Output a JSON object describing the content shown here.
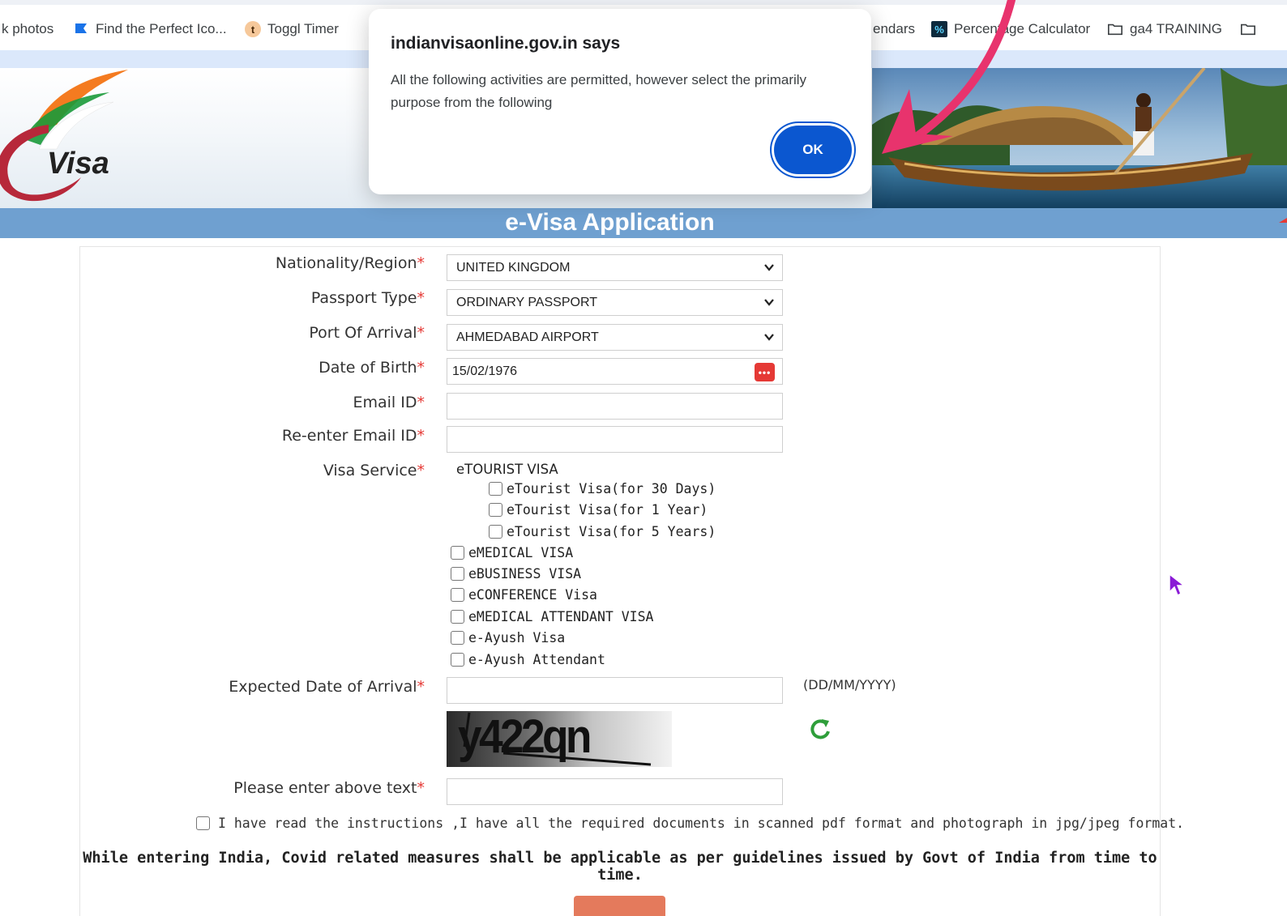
{
  "bookmarks": [
    {
      "label": "k photos",
      "icon": "photos-icon"
    },
    {
      "label": "Find the Perfect Ico...",
      "icon": "flag-icon"
    },
    {
      "label": "Toggl Timer",
      "icon": "toggl-icon"
    },
    {
      "label": "endars",
      "icon": "calendar-icon"
    },
    {
      "label": "Percentage Calculator",
      "icon": "percent-icon"
    },
    {
      "label": "ga4 TRAINING",
      "icon": "folder-icon"
    }
  ],
  "header": {
    "logo_text": "Visa",
    "title": "e-Visa Application"
  },
  "dialog": {
    "title": "indianvisaonline.gov.in says",
    "message": "All the following activities are permitted, however select the primarily purpose from the following",
    "ok_label": "OK"
  },
  "form": {
    "required_mark": "*",
    "nationality": {
      "label": "Nationality/Region",
      "value": "UNITED KINGDOM"
    },
    "passport_type": {
      "label": "Passport Type",
      "value": "ORDINARY PASSPORT"
    },
    "port_of_arrival": {
      "label": "Port Of Arrival",
      "value": "AHMEDABAD AIRPORT"
    },
    "date_of_birth": {
      "label": "Date of Birth",
      "value": "15/02/1976"
    },
    "email": {
      "label": "Email ID",
      "value": ""
    },
    "reenter_email": {
      "label": "Re-enter Email ID",
      "value": ""
    },
    "visa_service": {
      "label": "Visa Service",
      "group_label": "eTOURIST VISA",
      "tourist_options": [
        "eTourist Visa(for 30 Days)",
        "eTourist Visa(for 1 Year)",
        "eTourist Visa(for 5 Years)"
      ],
      "other_options": [
        "eMEDICAL VISA",
        "eBUSINESS VISA",
        "eCONFERENCE Visa",
        "eMEDICAL ATTENDANT VISA",
        "e-Ayush Visa",
        "e-Ayush Attendant"
      ]
    },
    "expected_arrival": {
      "label": "Expected Date of Arrival",
      "value": "",
      "format_hint": "(DD/MM/YYYY)"
    },
    "captcha": {
      "text": "y422qn",
      "input_label": "Please enter above text",
      "value": ""
    },
    "agreement": "I have read the instructions ,I have all the required documents in scanned pdf format and photograph in jpg/jpeg format.",
    "covid_notice": "While entering India, Covid related measures shall be applicable as per guidelines issued by Govt of India from time to time."
  },
  "colors": {
    "title_band": "#6fa0d0",
    "required": "#e53935",
    "dialog_button": "#0b57d0",
    "annotation_arrow": "#e8336d"
  }
}
